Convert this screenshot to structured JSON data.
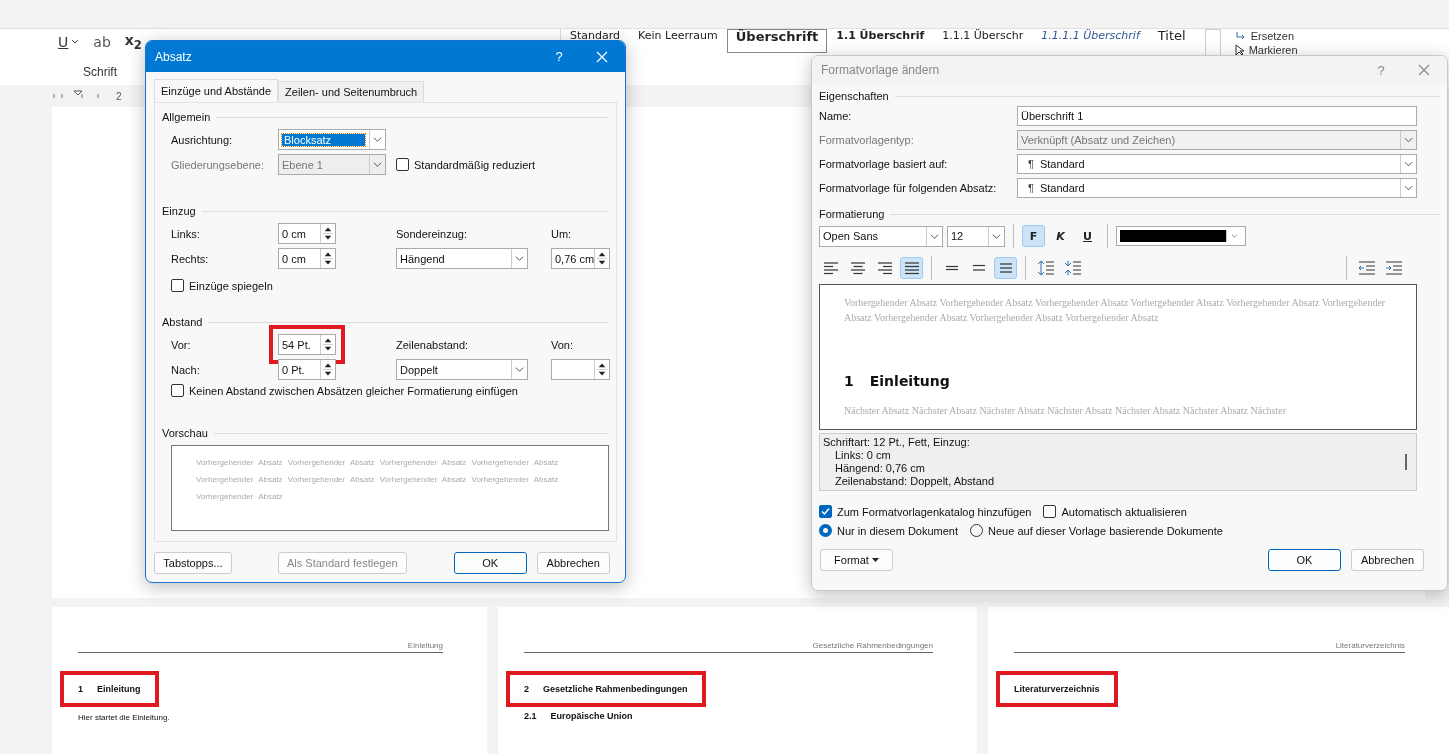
{
  "ribbon": {
    "font_buttons": [
      {
        "label": "U",
        "kind": "underline"
      },
      {
        "label": "ab",
        "kind": "strike"
      },
      {
        "label": "x$_{2}$",
        "kind": "sub"
      }
    ],
    "group_label": "Schrift",
    "styles": [
      {
        "label": "Standard",
        "kind": "normal",
        "selected": false
      },
      {
        "label": "Kein Leerraum",
        "kind": "normal",
        "selected": false
      },
      {
        "label": "Überschrift",
        "kind": "heading1",
        "selected": true
      },
      {
        "label": "1.1 Überschrif",
        "kind": "heading2",
        "selected": false
      },
      {
        "label": "1.1.1 Überschr",
        "kind": "heading3",
        "selected": false
      },
      {
        "label": "1.1.1.1 Überschrif",
        "kind": "heading4",
        "selected": false
      },
      {
        "label": "Titel",
        "kind": "title",
        "selected": false
      }
    ],
    "editing": [
      {
        "label": "Ersetzen",
        "kind": "replace"
      },
      {
        "label": "Markieren",
        "kind": "select"
      }
    ]
  },
  "ruler": {
    "mark": "2"
  },
  "pages": [
    {
      "header": "Einleitung",
      "blocks": [
        {
          "kind": "heading",
          "number": "1",
          "text": "Einleitung",
          "highlighted": true
        },
        {
          "kind": "body",
          "text": "Hier startet die Einleitung."
        }
      ]
    },
    {
      "header": "Gesetzliche Rahmenbedingungen",
      "blocks": [
        {
          "kind": "heading",
          "number": "2",
          "text": "Gesetzliche Rahmenbedingungen",
          "highlighted": true
        },
        {
          "kind": "subheading",
          "number": "2.1",
          "text": "Europäische Union"
        }
      ]
    },
    {
      "header": "Literaturverzeichnis",
      "blocks": [
        {
          "kind": "heading",
          "text": "Literaturverzeichnis",
          "highlighted": true
        }
      ]
    }
  ],
  "absatz_dialog": {
    "title": "Absatz",
    "help": "?",
    "tabs": [
      {
        "label": "Einzüge und Abstände",
        "selected": true
      },
      {
        "label": "Zeilen- und Seitenumbruch",
        "selected": false
      }
    ],
    "general": {
      "heading": "Allgemein",
      "alignment": {
        "label": "Ausrichtung:",
        "value": "Blocksatz"
      },
      "outline": {
        "label": "Gliederungsebene:",
        "value": "Ebene 1",
        "disabled": true
      },
      "collapsed": {
        "label": "Standardmäßig reduziert",
        "checked": false
      }
    },
    "indent": {
      "heading": "Einzug",
      "left": {
        "label": "Links:",
        "value": "0 cm"
      },
      "right": {
        "label": "Rechts:",
        "value": "0 cm"
      },
      "special": {
        "label": "Sondereinzug:",
        "value": "Hängend"
      },
      "by": {
        "label": "Um:",
        "value": "0,76 cm"
      },
      "mirror": {
        "label": "Einzüge spiegeln",
        "checked": false
      }
    },
    "spacing": {
      "heading": "Abstand",
      "before": {
        "label": "Vor:",
        "value": "54 Pt.",
        "highlighted": true
      },
      "after": {
        "label": "Nach:",
        "value": "0 Pt.",
        "highlighted": false
      },
      "line": {
        "label": "Zeilenabstand:",
        "value": "Doppelt"
      },
      "at": {
        "label": "Von:"
      },
      "no_space": {
        "label": "Keinen Abstand zwischen Absätzen gleicher Formatierung einfügen",
        "checked": false
      }
    },
    "preview": {
      "heading": "Vorschau",
      "text": "Vorhergehender Absatz Vorhergehender Absatz Vorhergehender Absatz Vorhergehender Absatz Vorhergehender Absatz Vorhergehender Absatz Vorhergehender Absatz Vorhergehender Absatz Vorhergehender Absatz"
    },
    "buttons": [
      {
        "label": "Tabstopps...",
        "kind": "normal",
        "disabled": false
      },
      {
        "label": "Als Standard festlegen",
        "kind": "normal",
        "disabled": true
      },
      {
        "label": "OK",
        "kind": "default",
        "disabled": false
      },
      {
        "label": "Abbrechen",
        "kind": "normal",
        "disabled": false
      }
    ]
  },
  "format_dialog": {
    "title": "Formatvorlage ändern",
    "help": "?",
    "properties_heading": "Eigenschaften",
    "properties": [
      {
        "label": "Name:",
        "value": "Überschrift 1",
        "kind": "text",
        "disabled": false
      },
      {
        "label": "Formatvorlagentyp:",
        "value": "Verknüpft (Absatz und Zeichen)",
        "kind": "select",
        "disabled": true
      },
      {
        "label": "Formatvorlage basiert auf:",
        "mark": "¶",
        "value": "Standard",
        "kind": "select",
        "disabled": false
      },
      {
        "label": "Formatvorlage für folgenden Absatz:",
        "mark": "¶",
        "value": "Standard",
        "kind": "select",
        "disabled": false
      }
    ],
    "formatting_heading": "Formatierung",
    "font": "Open Sans",
    "size": "12",
    "styles": [
      {
        "label": "F",
        "kind": "bold",
        "on": true
      },
      {
        "label": "K",
        "kind": "italic",
        "on": false
      },
      {
        "label": "U",
        "kind": "underline",
        "on": false
      }
    ],
    "alignments": [
      {
        "kind": "left",
        "selected": false
      },
      {
        "kind": "center",
        "selected": false
      },
      {
        "kind": "right",
        "selected": false
      },
      {
        "kind": "justify",
        "selected": true
      }
    ],
    "line_spacing": [
      {
        "kind": "single",
        "selected": false
      },
      {
        "kind": "onehalf",
        "selected": false
      },
      {
        "kind": "double",
        "selected": true
      }
    ],
    "preview": {
      "before": "Vorhergehender Absatz Vorhergehender Absatz Vorhergehender Absatz Vorhergehender Absatz Vorhergehender Absatz Vorhergehender Absatz Vorhergehender Absatz Vorhergehender Absatz Vorhergehender Absatz",
      "number": "1",
      "heading": "Einleitung",
      "after": "Nächster Absatz Nächster Absatz Nächster Absatz Nächster Absatz Nächster Absatz Nächster Absatz Nächster"
    },
    "description": {
      "lead": "Schriftart: 12 Pt., Fett, Einzug:",
      "lines": [
        "Links:  0 cm",
        "Hängend:  0,76 cm",
        "Zeilenabstand:  Doppelt, Abstand"
      ]
    },
    "options": [
      {
        "label": "Zum Formatvorlagenkatalog hinzufügen",
        "checked": true
      },
      {
        "label": "Automatisch aktualisieren",
        "checked": false
      }
    ],
    "scope": [
      {
        "label": "Nur in diesem Dokument",
        "selected": true
      },
      {
        "label": "Neue auf dieser Vorlage basierende Dokumente",
        "selected": false
      }
    ],
    "buttons": [
      {
        "label": "Format",
        "kind": "menu"
      },
      {
        "label": "OK",
        "kind": "default"
      },
      {
        "label": "Abbrechen",
        "kind": "normal"
      }
    ]
  }
}
